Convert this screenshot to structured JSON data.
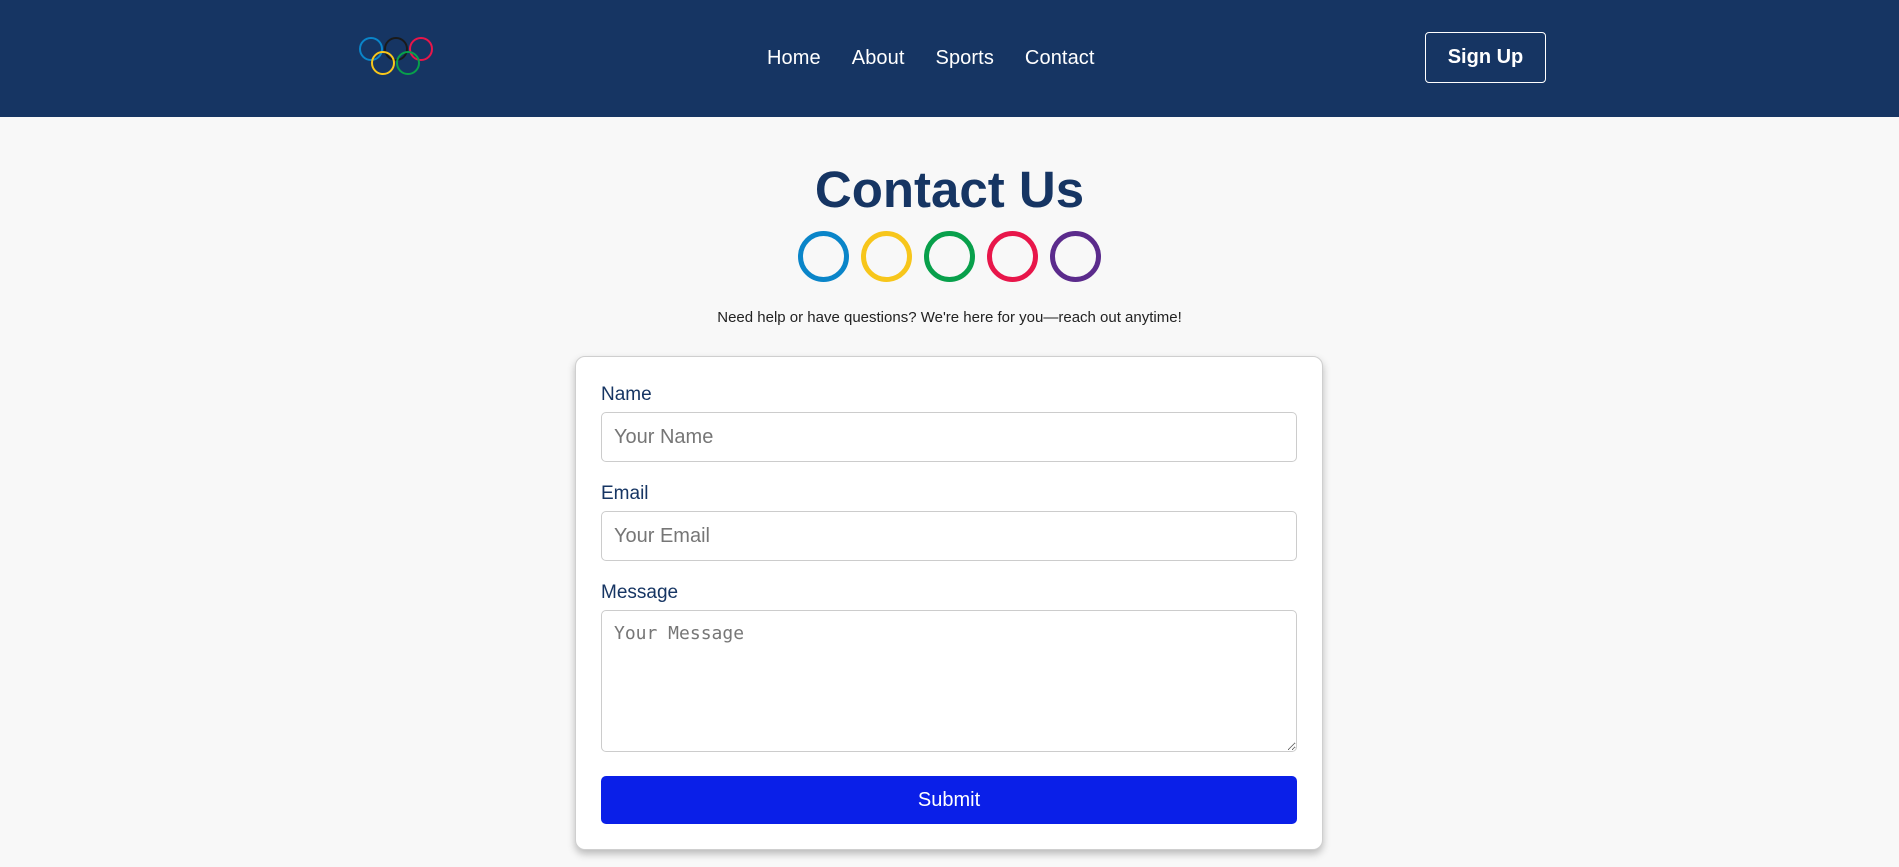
{
  "header": {
    "logo_icon": "olympic-rings-icon",
    "nav": [
      {
        "label": "Home"
      },
      {
        "label": "About"
      },
      {
        "label": "Sports"
      },
      {
        "label": "Contact"
      }
    ],
    "signup_label": "Sign Up",
    "colors": {
      "background": "#163563"
    }
  },
  "hero": {
    "title": "Contact Us",
    "ring_colors": [
      "#0a85c9",
      "#f7c61b",
      "#08a04b",
      "#e8164a",
      "#5b2b8c"
    ],
    "subtitle": "Need help or have questions? We're here for you—reach out anytime!"
  },
  "form": {
    "name_label": "Name",
    "name_placeholder": "Your Name",
    "email_label": "Email",
    "email_placeholder": "Your Email",
    "message_label": "Message",
    "message_placeholder": "Your Message",
    "submit_label": "Submit",
    "colors": {
      "submit": "#0a1fe8",
      "label": "#163563"
    }
  }
}
